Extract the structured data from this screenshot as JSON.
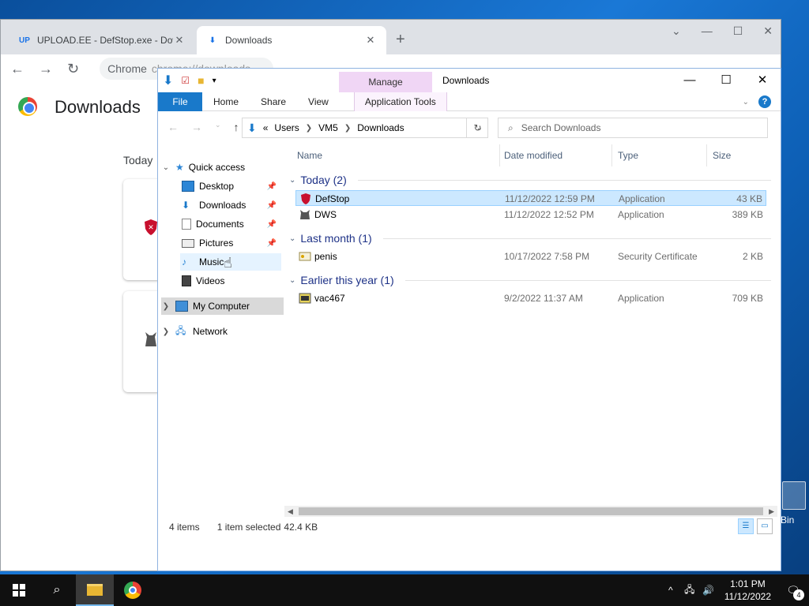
{
  "chrome": {
    "tabs": [
      {
        "favicon": "UP",
        "title": "UPLOAD.EE - DefStop.exe - Dow"
      },
      {
        "favicon": "⬇",
        "title": "Downloads"
      }
    ],
    "omnibox_chip": "Chrome",
    "omnibox_url": "chrome://downloads",
    "page_title": "Downloads",
    "section_today": "Today"
  },
  "explorer": {
    "manage_label": "Manage",
    "window_title": "Downloads",
    "ribbon_tabs": [
      "File",
      "Home",
      "Share",
      "View",
      "Application Tools"
    ],
    "address": {
      "prefix": "«",
      "parts": [
        "Users",
        "VM5",
        "Downloads"
      ]
    },
    "search_placeholder": "Search Downloads",
    "nav": {
      "quick_access": "Quick access",
      "items": [
        "Desktop",
        "Downloads",
        "Documents",
        "Pictures",
        "Music",
        "Videos"
      ],
      "my_computer": "My Computer",
      "network": "Network"
    },
    "columns": {
      "name": "Name",
      "date": "Date modified",
      "type": "Type",
      "size": "Size"
    },
    "groups": [
      {
        "label": "Today (2)",
        "files": [
          {
            "name": "DefStop",
            "date": "11/12/2022 12:59 PM",
            "type": "Application",
            "size": "43 KB",
            "selected": true
          },
          {
            "name": "DWS",
            "date": "11/12/2022 12:52 PM",
            "type": "Application",
            "size": "389 KB",
            "selected": false
          }
        ]
      },
      {
        "label": "Last month (1)",
        "files": [
          {
            "name": "penis",
            "date": "10/17/2022 7:58 PM",
            "type": "Security Certificate",
            "size": "2 KB",
            "selected": false
          }
        ]
      },
      {
        "label": "Earlier this year (1)",
        "files": [
          {
            "name": "vac467",
            "date": "9/2/2022 11:37 AM",
            "type": "Application",
            "size": "709 KB",
            "selected": false
          }
        ]
      }
    ],
    "status": {
      "items": "4 items",
      "selected": "1 item selected",
      "size": "42.4 KB"
    }
  },
  "desktop": {
    "recycle_bin_label": "Bin"
  },
  "taskbar": {
    "time": "1:01 PM",
    "date": "11/12/2022",
    "notifications": "4"
  }
}
